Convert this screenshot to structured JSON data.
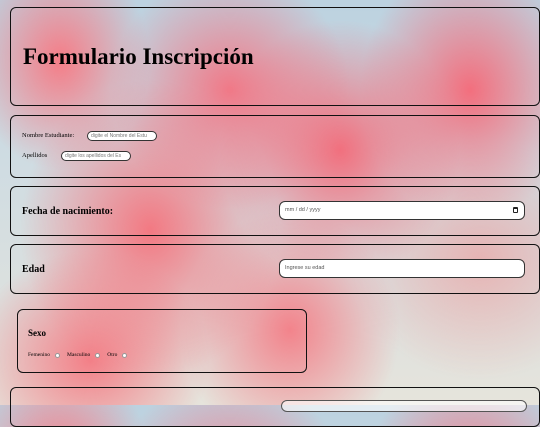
{
  "header": {
    "title": "Formulario Inscripción"
  },
  "student": {
    "name_label": "Nombre Estudiante:",
    "name_placeholder": "digite el Nombre del Estu",
    "lastname_label": "Apellidos",
    "lastname_placeholder": "digite los apellidos del Es"
  },
  "birth": {
    "label": "Fecha de nacimiento:",
    "placeholder": "mm / dd / yyyy",
    "icon": "calendar-icon"
  },
  "age": {
    "label": "Edad",
    "placeholder": "Ingrese su edad"
  },
  "sex": {
    "title": "Sexo",
    "options": [
      "Femenino",
      "Masculino",
      "Otro"
    ]
  },
  "colors": {
    "panel_border": "#111111",
    "balloon": "#f6707e",
    "sky": "#bcd2e0"
  }
}
